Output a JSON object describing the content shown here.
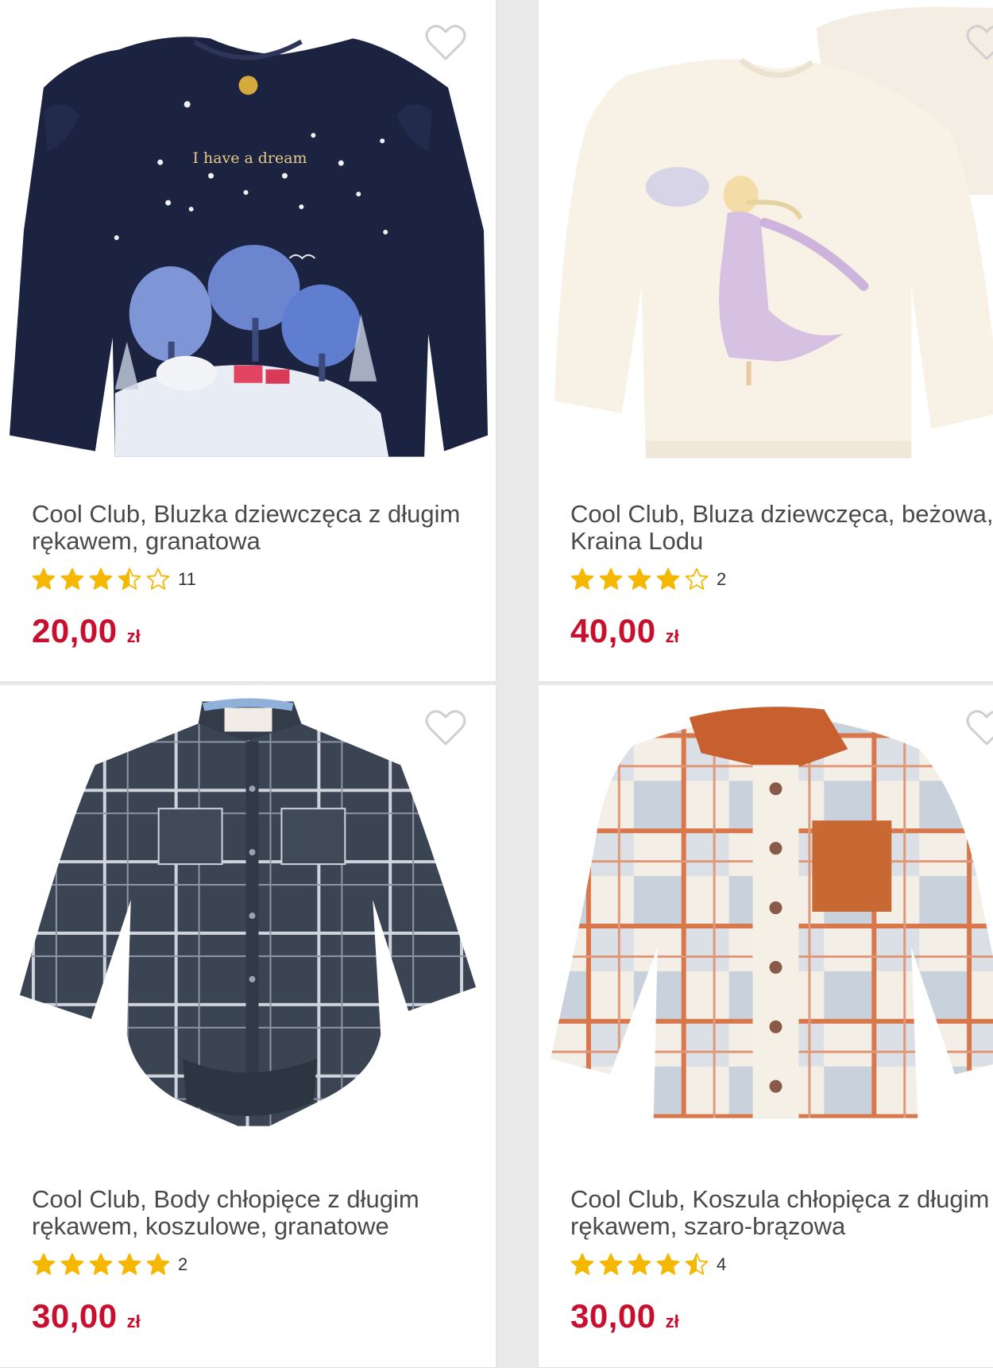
{
  "products": [
    {
      "title": "Cool Club, Bluzka dziewczęca z długim rękawem, granatowa",
      "rating": 3.5,
      "review_count": "11",
      "price": "20,00",
      "currency": "zł",
      "image_text": "I have a dream",
      "image_icon": "navy-long-sleeve-blouse"
    },
    {
      "title": "Cool Club, Bluza dziewczęca, beżowa, Kraina Lodu",
      "rating": 4,
      "review_count": "2",
      "price": "40,00",
      "currency": "zł",
      "image_icon": "beige-frozen-sweatshirt"
    },
    {
      "title": "Cool Club, Body chłopięce z długim rękawem, koszulowe, granatowe",
      "rating": 5,
      "review_count": "2",
      "price": "30,00",
      "currency": "zł",
      "image_icon": "navy-plaid-shirt-bodysuit"
    },
    {
      "title": "Cool Club, Koszula chłopięca z długim rękawem, szaro-brązowa",
      "rating": 4.5,
      "review_count": "4",
      "price": "30,00",
      "currency": "zł",
      "image_icon": "grey-orange-plaid-shirt"
    }
  ],
  "colors": {
    "price": "#c8102e",
    "star": "#f5b700",
    "title": "#4a4a4a",
    "heart_outline": "#cfcfcf"
  }
}
